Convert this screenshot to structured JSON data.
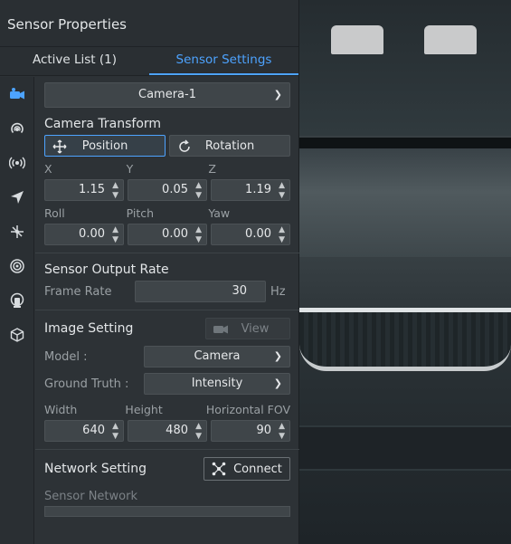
{
  "panel": {
    "title": "Sensor Properties"
  },
  "tabs": [
    {
      "label": "Active List (1)",
      "active": false
    },
    {
      "label": "Sensor Settings",
      "active": true
    }
  ],
  "sidebar": {
    "icons": [
      "camera-icon",
      "radar-icon",
      "broadcast-icon",
      "navigation-arrow-icon",
      "imu-axes-icon",
      "ultrasonic-icon",
      "lidar-icon",
      "cube-icon"
    ]
  },
  "sensor_select": {
    "value": "Camera-1"
  },
  "camera_transform": {
    "title": "Camera Transform",
    "position_label": "Position",
    "rotation_label": "Rotation",
    "x_label": "X",
    "y_label": "Y",
    "z_label": "Z",
    "x": "1.15",
    "y": "0.05",
    "z": "1.19",
    "roll_label": "Roll",
    "pitch_label": "Pitch",
    "yaw_label": "Yaw",
    "roll": "0.00",
    "pitch": "0.00",
    "yaw": "0.00"
  },
  "output_rate": {
    "title": "Sensor Output Rate",
    "frame_rate_label": "Frame Rate",
    "frame_rate": "30",
    "unit": "Hz"
  },
  "image_setting": {
    "title": "Image Setting",
    "view_label": "View",
    "model_label": "Model :",
    "model_value": "Camera",
    "ground_truth_label": "Ground Truth :",
    "ground_truth_value": "Intensity",
    "width_label": "Width",
    "height_label": "Height",
    "fov_label": "Horizontal FOV",
    "width": "640",
    "height": "480",
    "fov": "90"
  },
  "network": {
    "title": "Network Setting",
    "connect_label": "Connect",
    "sensor_network_label": "Sensor Network"
  },
  "colors": {
    "accent": "#4da3ff",
    "panel_bg": "#2d3236",
    "field_bg": "#3f4549"
  }
}
